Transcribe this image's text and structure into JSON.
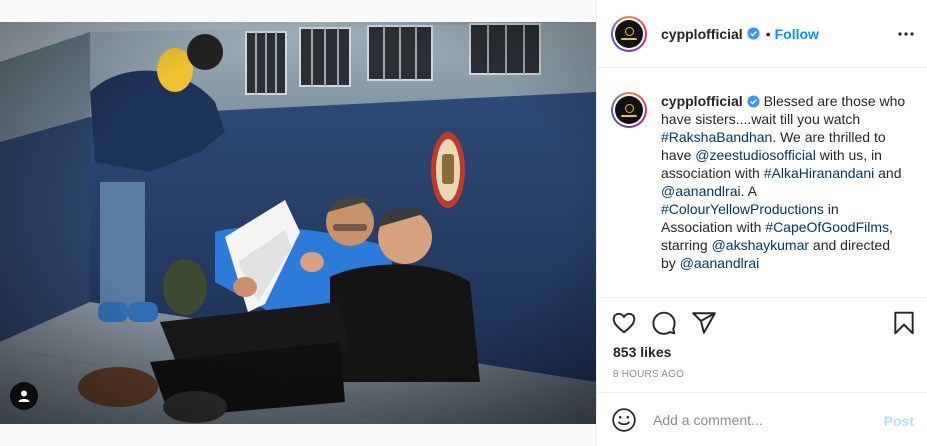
{
  "post": {
    "author": {
      "username": "cypplofficial",
      "verified": true,
      "avatar_icon": "colour-yellow-logo-icon"
    },
    "follow_label": "Follow",
    "separator": "•",
    "caption": {
      "username": "cypplofficial",
      "segments": [
        {
          "type": "text",
          "value": " Blessed are those who have sisters....wait till you watch "
        },
        {
          "type": "tag",
          "value": "#RakshaBandhan"
        },
        {
          "type": "text",
          "value": ". We are thrilled to have "
        },
        {
          "type": "tag",
          "value": "@zeestudiosofficial"
        },
        {
          "type": "text",
          "value": " with us, in association with "
        },
        {
          "type": "tag",
          "value": "#AlkaHiranandani"
        },
        {
          "type": "text",
          "value": " and "
        },
        {
          "type": "tag",
          "value": "@aanandlrai"
        },
        {
          "type": "text",
          "value": ". A "
        },
        {
          "type": "tag",
          "value": "#ColourYellowProductions"
        },
        {
          "type": "text",
          "value": " in Association with "
        },
        {
          "type": "tag",
          "value": "#CapeOfGoodFilms"
        },
        {
          "type": "text",
          "value": ", starring "
        },
        {
          "type": "tag",
          "value": "@akshaykumar"
        },
        {
          "type": "text",
          "value": " and directed by "
        },
        {
          "type": "tag",
          "value": "@aanandlrai"
        }
      ]
    },
    "likes": "853 likes",
    "time_ago": "8 HOURS AGO",
    "comment": {
      "placeholder": "Add a comment...",
      "value": "",
      "post_label": "Post"
    },
    "icons": {
      "like": "heart-icon",
      "comment": "comment-bubble-icon",
      "share": "paper-plane-icon",
      "save": "bookmark-icon",
      "more": "more-options-icon",
      "emoji": "emoji-smiley-icon",
      "user_tag": "user-tag-icon"
    },
    "colors": {
      "link": "#0095f6",
      "tag": "#00376b",
      "muted": "#8e8e8e",
      "post_disabled": "#b2dffc"
    }
  }
}
